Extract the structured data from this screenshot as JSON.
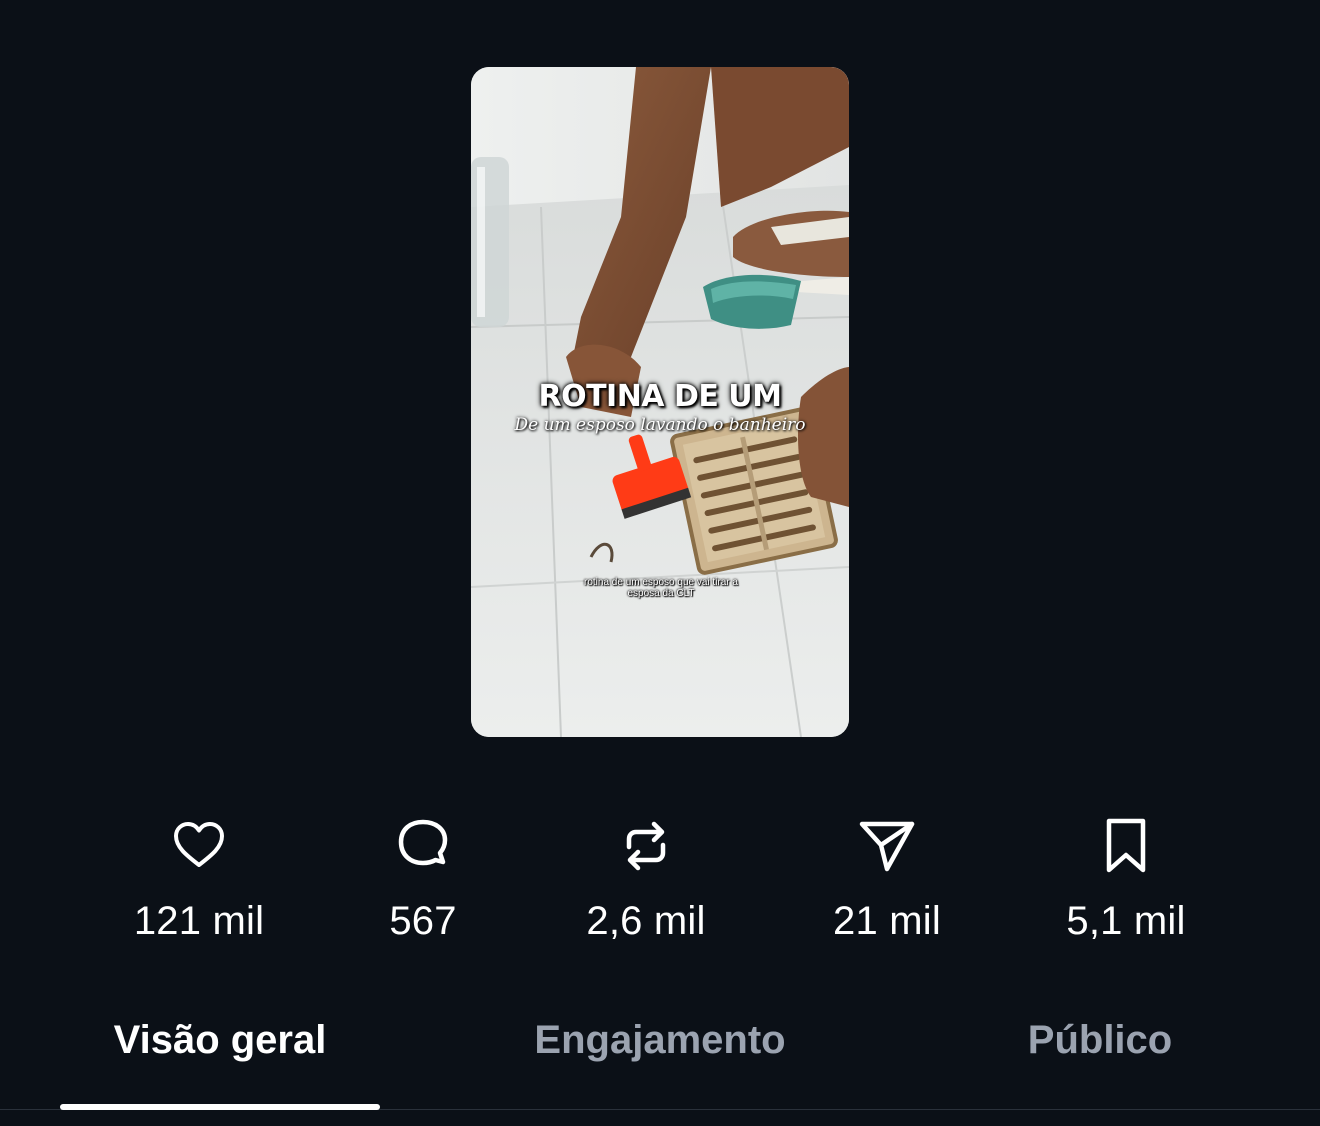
{
  "video": {
    "overlay_title": "ROTINA DE UM",
    "overlay_subtitle": "De um esposo lavando o banheiro",
    "overlay_caption": "rotina de um esposo que vai tirar a esposa da CLT"
  },
  "stats": {
    "likes": {
      "icon": "heart-icon",
      "value": "121 mil"
    },
    "comments": {
      "icon": "comment-icon",
      "value": "567"
    },
    "reposts": {
      "icon": "repost-icon",
      "value": "2,6 mil"
    },
    "shares": {
      "icon": "send-icon",
      "value": "21 mil"
    },
    "saves": {
      "icon": "bookmark-icon",
      "value": "5,1 mil"
    }
  },
  "tabs": [
    {
      "label": "Visão geral",
      "active": true
    },
    {
      "label": "Engajamento",
      "active": false
    },
    {
      "label": "Público",
      "active": false
    }
  ],
  "colors": {
    "background": "#0b1017",
    "text_primary": "#ffffff",
    "text_inactive": "#9ba3b0",
    "accent_red": "#ff3b16"
  }
}
